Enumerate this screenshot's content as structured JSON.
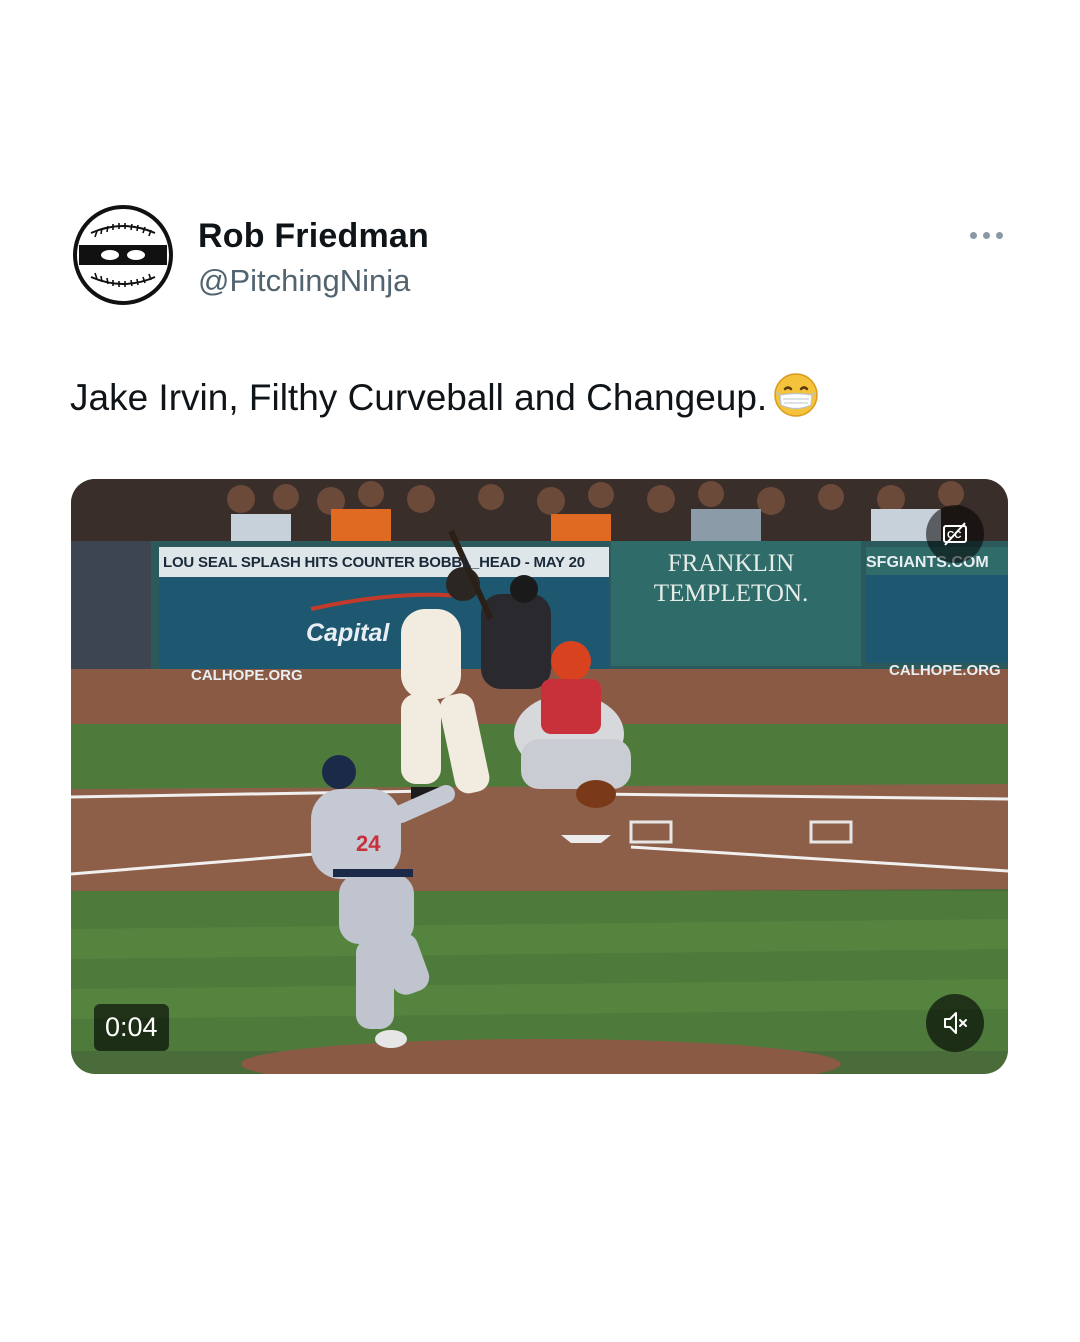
{
  "author": {
    "name": "Rob Friedman",
    "handle": "@PitchingNinja",
    "avatar_icon": "ninja-baseball-icon"
  },
  "more_icon": "more-options-icon",
  "tweet": {
    "text": "Jake Irvin, Filthy Curveball and Changeup.",
    "emoji": "face-with-medical-mask-emoji"
  },
  "video": {
    "timestamp": "0:04",
    "captions_icon": "captions-off-icon",
    "mute_icon": "volume-muted-icon",
    "signs": {
      "banner_left": "LOU SEAL SPLASH HITS COUNTER BOBBL_HEAD - MAY 20",
      "franklin_line1": "FRANKLIN",
      "franklin_line2": "TEMPLETON.",
      "sfgiants": "SFGIANTS.COM",
      "calhope_left": "CALHOPE.ORG",
      "calhope_right": "CALHOPE.ORG",
      "capital": "Capital"
    }
  },
  "colors": {
    "name_text": "#0f1419",
    "handle_text": "#536471",
    "grass": "#4e7a3c",
    "dirt": "#8a5a44",
    "wall": "#2c5a5c"
  }
}
